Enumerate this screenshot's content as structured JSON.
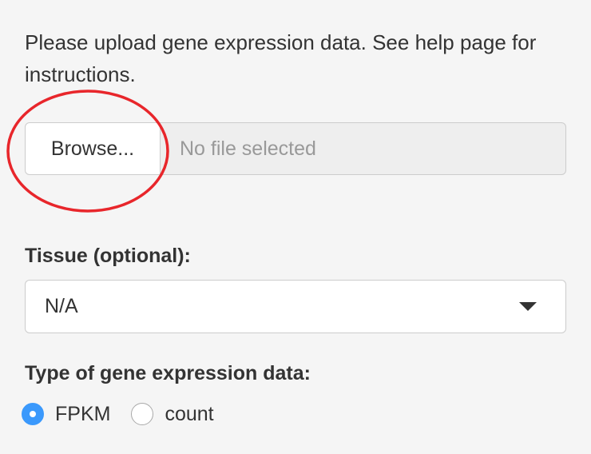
{
  "instructions": "Please upload gene expression data. See help page for instructions.",
  "file_upload": {
    "browse_label": "Browse...",
    "file_status": "No file selected"
  },
  "tissue": {
    "label": "Tissue (optional):",
    "selected_value": "N/A"
  },
  "data_type": {
    "label": "Type of gene expression data:",
    "options": [
      {
        "label": "FPKM",
        "checked": true
      },
      {
        "label": "count",
        "checked": false
      }
    ]
  },
  "colors": {
    "radio_accent": "#3b99fc",
    "highlight_circle": "#e8262b"
  }
}
